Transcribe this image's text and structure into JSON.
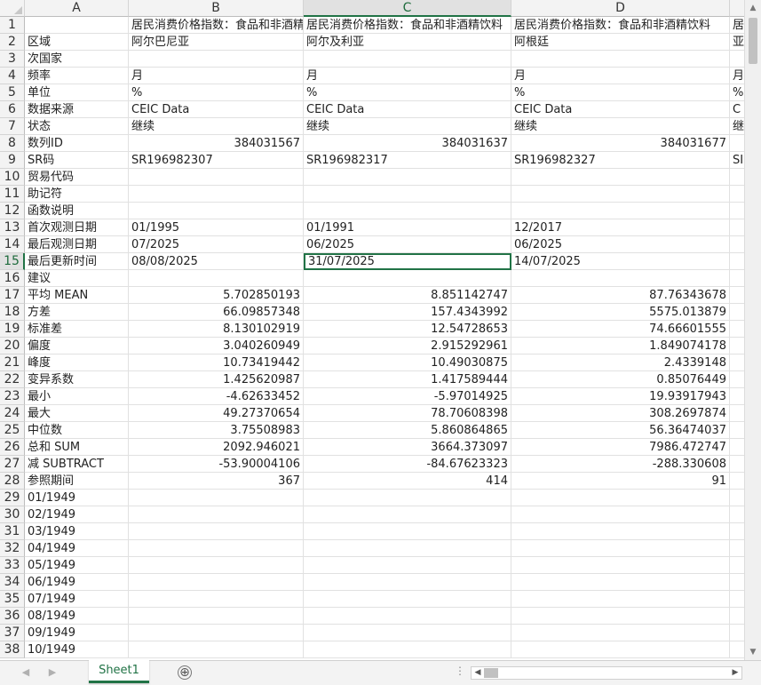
{
  "columns": [
    "A",
    "B",
    "C",
    "D",
    "E"
  ],
  "selected_column": "C",
  "selected_row": "15",
  "rows": [
    {
      "n": "1",
      "cells": [
        "",
        "居民消费价格指数：食品和非酒精饮料",
        "居民消费价格指数：食品和非酒精饮料",
        "居民消费价格指数：食品和非酒精饮料",
        "居民"
      ]
    },
    {
      "n": "2",
      "cells": [
        "区域",
        "阿尔巴尼亚",
        "阿尔及利亚",
        "阿根廷",
        "亚"
      ]
    },
    {
      "n": "3",
      "cells": [
        "次国家",
        "",
        "",
        "",
        ""
      ]
    },
    {
      "n": "4",
      "cells": [
        "频率",
        "月",
        "月",
        "月",
        "月"
      ]
    },
    {
      "n": "5",
      "cells": [
        "单位",
        "%",
        "%",
        "%",
        "%"
      ]
    },
    {
      "n": "6",
      "cells": [
        "数据来源",
        "CEIC Data",
        "CEIC Data",
        "CEIC Data",
        "C"
      ]
    },
    {
      "n": "7",
      "cells": [
        "状态",
        "继续",
        "继续",
        "继续",
        "继"
      ]
    },
    {
      "n": "8",
      "cells": [
        "数列ID",
        "384031567",
        "384031637",
        "384031677",
        ""
      ]
    },
    {
      "n": "9",
      "cells": [
        "SR码",
        "SR196982307",
        "SR196982317",
        "SR196982327",
        "SI"
      ]
    },
    {
      "n": "10",
      "cells": [
        "贸易代码",
        "",
        "",
        "",
        ""
      ]
    },
    {
      "n": "11",
      "cells": [
        "助记符",
        "",
        "",
        "",
        ""
      ]
    },
    {
      "n": "12",
      "cells": [
        "函数说明",
        "",
        "",
        "",
        ""
      ]
    },
    {
      "n": "13",
      "cells": [
        "首次观测日期",
        "01/1995",
        "01/1991",
        "12/2017",
        "0"
      ]
    },
    {
      "n": "14",
      "cells": [
        "最后观测日期",
        "07/2025",
        "06/2025",
        "06/2025",
        "0"
      ]
    },
    {
      "n": "15",
      "cells": [
        "最后更新时间",
        "08/08/2025",
        "31/07/2025",
        "14/07/2025",
        "0"
      ]
    },
    {
      "n": "16",
      "cells": [
        "建议",
        "",
        "",
        "",
        ""
      ]
    },
    {
      "n": "17",
      "cells": [
        "平均 MEAN",
        "5.702850193",
        "8.851142747",
        "87.76343678",
        ""
      ]
    },
    {
      "n": "18",
      "cells": [
        "方差",
        "66.09857348",
        "157.4343992",
        "5575.013879",
        ""
      ]
    },
    {
      "n": "19",
      "cells": [
        "标准差",
        "8.130102919",
        "12.54728653",
        "74.66601555",
        ""
      ]
    },
    {
      "n": "20",
      "cells": [
        "偏度",
        "3.040260949",
        "2.915292961",
        "1.849074178",
        ""
      ]
    },
    {
      "n": "21",
      "cells": [
        "峰度",
        "10.73419442",
        "10.49030875",
        "2.4339148",
        ""
      ]
    },
    {
      "n": "22",
      "cells": [
        "变异系数",
        "1.425620987",
        "1.417589444",
        "0.85076449",
        ""
      ]
    },
    {
      "n": "23",
      "cells": [
        "最小",
        "-4.62633452",
        "-5.97014925",
        "19.93917943",
        ""
      ]
    },
    {
      "n": "24",
      "cells": [
        "最大",
        "49.27370654",
        "78.70608398",
        "308.2697874",
        ""
      ]
    },
    {
      "n": "25",
      "cells": [
        "中位数",
        "3.75508983",
        "5.860864865",
        "56.36474037",
        ""
      ]
    },
    {
      "n": "26",
      "cells": [
        "总和 SUM",
        "2092.946021",
        "3664.373097",
        "7986.472747",
        ""
      ]
    },
    {
      "n": "27",
      "cells": [
        "减 SUBTRACT",
        "-53.90004106",
        "-84.67623323",
        "-288.330608",
        ""
      ]
    },
    {
      "n": "28",
      "cells": [
        "参照期间",
        "367",
        "414",
        "91",
        ""
      ]
    },
    {
      "n": "29",
      "cells": [
        "01/1949",
        "",
        "",
        "",
        ""
      ]
    },
    {
      "n": "30",
      "cells": [
        "02/1949",
        "",
        "",
        "",
        ""
      ]
    },
    {
      "n": "31",
      "cells": [
        "03/1949",
        "",
        "",
        "",
        ""
      ]
    },
    {
      "n": "32",
      "cells": [
        "04/1949",
        "",
        "",
        "",
        ""
      ]
    },
    {
      "n": "33",
      "cells": [
        "05/1949",
        "",
        "",
        "",
        ""
      ]
    },
    {
      "n": "34",
      "cells": [
        "06/1949",
        "",
        "",
        "",
        ""
      ]
    },
    {
      "n": "35",
      "cells": [
        "07/1949",
        "",
        "",
        "",
        ""
      ]
    },
    {
      "n": "36",
      "cells": [
        "08/1949",
        "",
        "",
        "",
        ""
      ]
    },
    {
      "n": "37",
      "cells": [
        "09/1949",
        "",
        "",
        "",
        ""
      ]
    },
    {
      "n": "38",
      "cells": [
        "10/1949",
        "",
        "",
        "",
        ""
      ]
    }
  ],
  "sheet_tab": "Sheet1",
  "add_sheet_symbol": "⊕",
  "scroll_dots": "⋮",
  "colors": {
    "accent": "#217346",
    "header_bg": "#f3f3f3",
    "selected_header_bg": "#e1e1e1"
  }
}
